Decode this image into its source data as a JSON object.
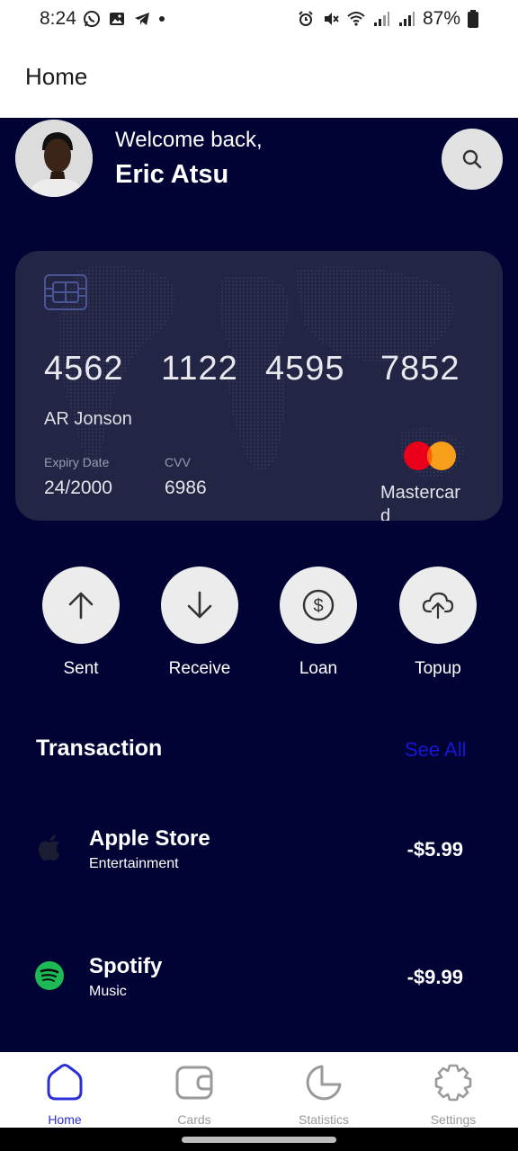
{
  "status_bar": {
    "time": "8:24",
    "battery": "87%",
    "left_icons": [
      "whatsapp-icon",
      "gallery-icon",
      "telegram-icon",
      "dot-icon"
    ],
    "right_icons": [
      "alarm-icon",
      "mute-icon",
      "wifi-icon",
      "signal-icon",
      "signal-icon",
      "battery-icon"
    ]
  },
  "app_bar": {
    "title": "Home"
  },
  "header": {
    "welcome": "Welcome back,",
    "user_name": "Eric Atsu",
    "search_icon": "search-icon"
  },
  "card": {
    "number_groups": [
      "4562",
      "1122",
      "4595",
      "7852"
    ],
    "holder": "AR Jonson",
    "expiry_label": "Expiry Date",
    "expiry_value": "24/2000",
    "cvv_label": "CVV",
    "cvv_value": "6986",
    "brand": "Mastercard"
  },
  "actions": [
    {
      "label": "Sent",
      "icon": "arrow-up-icon"
    },
    {
      "label": "Receive",
      "icon": "arrow-down-icon"
    },
    {
      "label": "Loan",
      "icon": "dollar-circle-icon"
    },
    {
      "label": "Topup",
      "icon": "cloud-upload-icon"
    }
  ],
  "transactions": {
    "title": "Transaction",
    "see_all": "See All",
    "items": [
      {
        "name": "Apple Store",
        "category": "Entertainment",
        "amount": "-$5.99",
        "icon": "apple-icon"
      },
      {
        "name": "Spotify",
        "category": "Music",
        "amount": "-$9.99",
        "icon": "spotify-icon"
      }
    ]
  },
  "bottom_nav": {
    "items": [
      {
        "label": "Home",
        "icon": "home-icon",
        "active": true
      },
      {
        "label": "Cards",
        "icon": "wallet-icon",
        "active": false
      },
      {
        "label": "Statistics",
        "icon": "pie-chart-icon",
        "active": false
      },
      {
        "label": "Settings",
        "icon": "settings-icon",
        "active": false
      }
    ]
  },
  "colors": {
    "background": "#000333",
    "card": "#222544",
    "accent": "#2a2fd6",
    "see_all": "#1616d8",
    "mastercard_red": "#eb001b",
    "mastercard_orange": "#f79e1b",
    "spotify_green": "#1db954"
  }
}
